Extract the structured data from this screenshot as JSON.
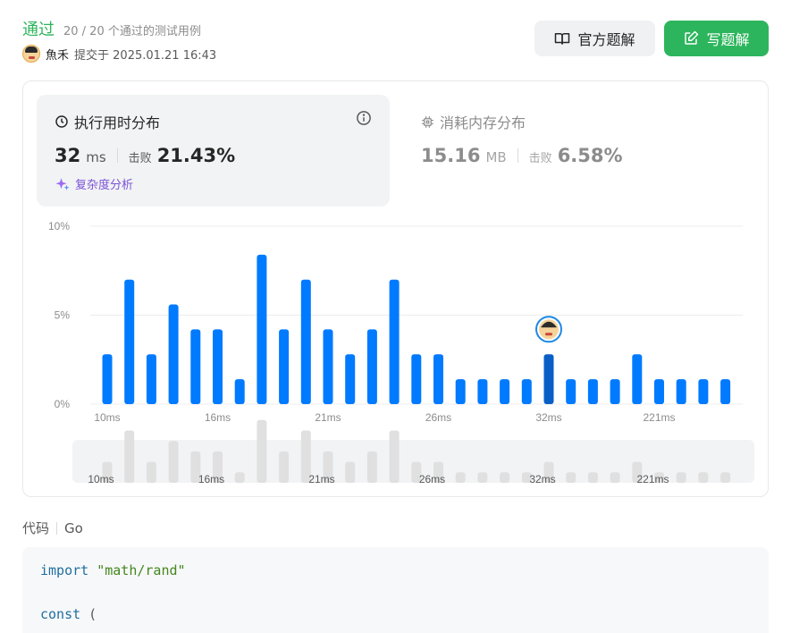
{
  "header": {
    "status": "通过",
    "tests": "20 / 20 个通过的测试用例",
    "user": "魚禾",
    "submitted": "提交于 2025.01.21 16:43",
    "editorial_button": "官方题解",
    "solution_button": "写题解"
  },
  "runtime": {
    "title": "执行用时分布",
    "value": "32",
    "unit": "ms",
    "beat_label": "击败",
    "beat": "21.43%",
    "complexity_link": "复杂度分析"
  },
  "memory": {
    "title": "消耗内存分布",
    "value": "15.16",
    "unit": "MB",
    "beat_label": "击败",
    "beat": "6.58%"
  },
  "chart_data": {
    "type": "bar",
    "ylabel": "",
    "xlabel": "",
    "y_ticks": [
      "10%",
      "5%",
      "0%"
    ],
    "ylim": [
      0,
      10
    ],
    "x_tick_labels": [
      "10ms",
      "16ms",
      "21ms",
      "26ms",
      "32ms",
      "221ms"
    ],
    "tick_indices": [
      0,
      5,
      10,
      15,
      20,
      25
    ],
    "values": [
      2.8,
      7.0,
      2.8,
      5.6,
      4.2,
      4.2,
      1.4,
      8.4,
      4.2,
      7.0,
      4.2,
      2.8,
      4.2,
      7.0,
      2.8,
      2.8,
      1.4,
      1.4,
      1.4,
      1.4,
      2.8,
      1.4,
      1.4,
      1.4,
      2.8,
      1.4,
      1.4,
      1.4,
      1.4
    ],
    "highlight_index": 20,
    "grid": true,
    "colors": {
      "bar": "#007aff",
      "highlight": "#0a5fc7",
      "overview_bar": "#e0e0e0",
      "grid": "#ececec"
    }
  },
  "code": {
    "label": "代码",
    "language": "Go",
    "lines": [
      {
        "kw": "import",
        "rest": " \"math/rand\""
      },
      {
        "kw": "",
        "rest": ""
      },
      {
        "kw": "const",
        "rest": " ("
      }
    ]
  }
}
